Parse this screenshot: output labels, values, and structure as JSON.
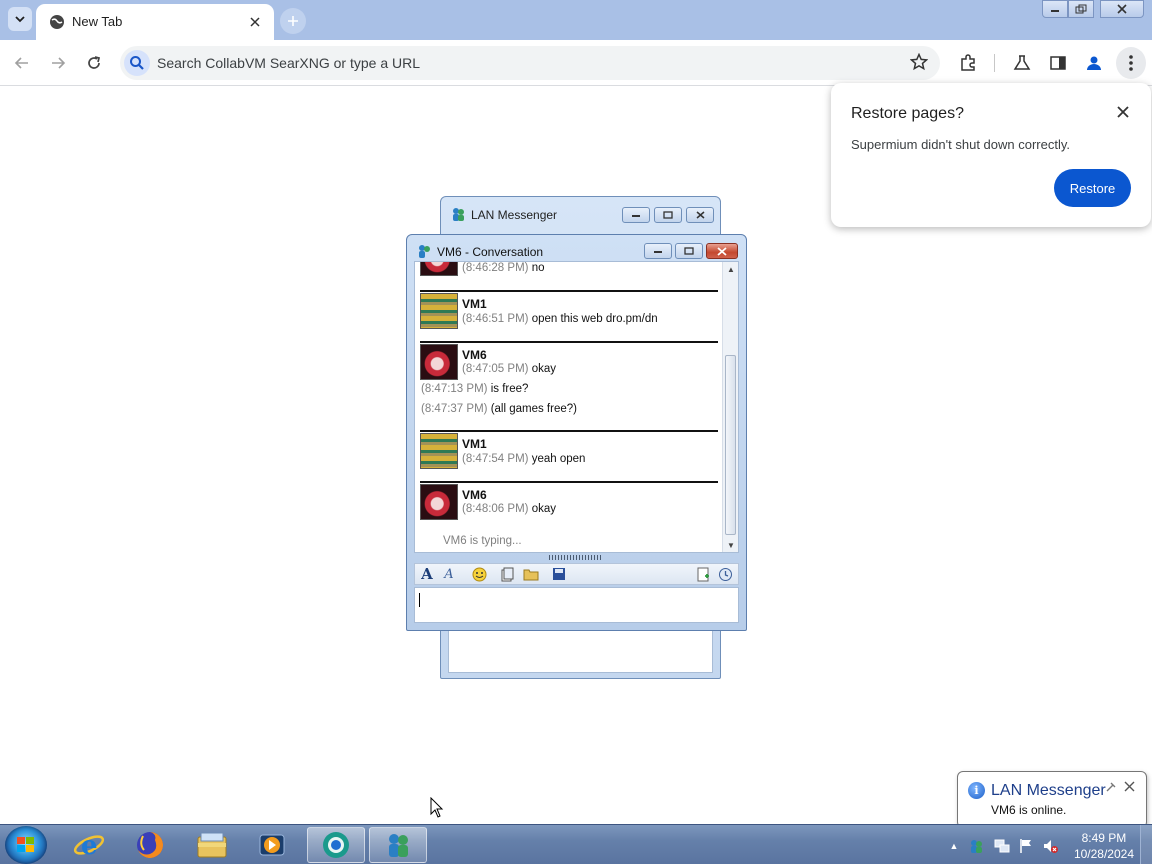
{
  "browser": {
    "tab_title": "New Tab",
    "omnibox_placeholder": "Search CollabVM SearXNG or type a URL"
  },
  "restore_popup": {
    "title": "Restore pages?",
    "message": "Supermium didn't shut down correctly.",
    "button": "Restore"
  },
  "lan_window": {
    "title": "LAN Messenger"
  },
  "conversation": {
    "title": "VM6 - Conversation",
    "partial_top": {
      "time": "(8:46:28 PM)",
      "text": "no"
    },
    "messages": [
      {
        "sender": "VM1",
        "lines": [
          {
            "time": "(8:46:51 PM)",
            "text": "open this web dro.pm/dn"
          }
        ]
      },
      {
        "sender": "VM6",
        "lines": [
          {
            "time": "(8:47:05 PM)",
            "text": "okay"
          },
          {
            "time": "(8:47:13 PM)",
            "text": "is free?"
          },
          {
            "time": "(8:47:37 PM)",
            "text": "(all games free?)"
          }
        ]
      },
      {
        "sender": "VM1",
        "lines": [
          {
            "time": "(8:47:54 PM)",
            "text": "yeah open"
          }
        ]
      },
      {
        "sender": "VM6",
        "lines": [
          {
            "time": "(8:48:06 PM)",
            "text": "okay"
          }
        ]
      }
    ],
    "typing_status": "VM6 is typing...",
    "input_value": ""
  },
  "notification": {
    "title": "LAN Messenger",
    "message": "VM6 is online."
  },
  "taskbar": {
    "time": "8:49 PM",
    "date": "10/28/2024"
  },
  "colors": {
    "tabstrip": "#a9c0e6",
    "accent": "#0b57d0",
    "taskbar": "#6580aa"
  },
  "icons": {
    "taskbar": [
      "start-orb",
      "internet-explorer-icon",
      "firefox-icon",
      "file-explorer-icon",
      "media-player-icon",
      "supermium-icon",
      "lan-messenger-icon"
    ]
  }
}
